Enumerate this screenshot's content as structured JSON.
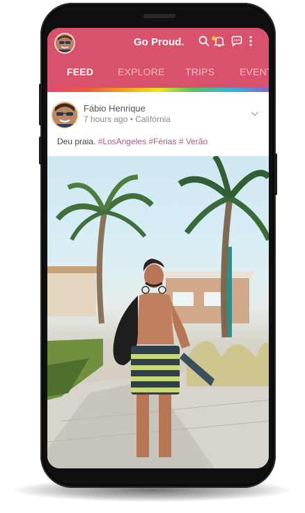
{
  "app": {
    "title": "Go Proud."
  },
  "tabs": [
    {
      "label": "FEED",
      "active": true
    },
    {
      "label": "EXPLORE"
    },
    {
      "label": "TRIPS"
    },
    {
      "label": "EVENTS"
    }
  ],
  "header_icons": [
    "search-icon",
    "bell-icon",
    "chat-icon",
    "more-vert-icon"
  ],
  "post": {
    "author": "Fábio Henrique",
    "time": "7 hours ago",
    "separator": "•",
    "location": "Califórnia",
    "caption_text": "Deu praia.",
    "hashtags": [
      "#LosAngeles",
      "#Férias",
      "# Verão"
    ]
  },
  "colors": {
    "brand": "#d8526e",
    "hashtag": "#a55b86",
    "notification": "#f4c21c"
  }
}
